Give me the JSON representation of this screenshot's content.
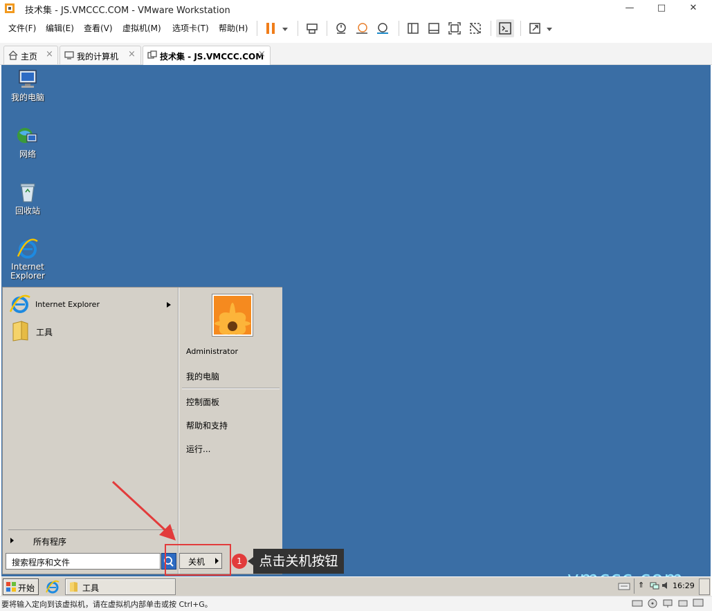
{
  "window": {
    "title": "技术集 - JS.VMCCC.COM - VMware Workstation",
    "minimize": "—",
    "maximize": "□",
    "close": "✕"
  },
  "menu": [
    "文件(F)",
    "编辑(E)",
    "查看(V)",
    "虚拟机(M)",
    "选项卡(T)",
    "帮助(H)"
  ],
  "tabs": [
    {
      "label": "主页",
      "icon": "home-icon"
    },
    {
      "label": "我的计算机",
      "icon": "monitor-icon"
    },
    {
      "label": "技术集 - JS.VMCCC.COM",
      "icon": "vm-icon",
      "active": true
    }
  ],
  "desktop_icons": [
    {
      "label": "我的电脑",
      "icon": "computer-icon"
    },
    {
      "label": "网络",
      "icon": "network-icon"
    },
    {
      "label": "回收站",
      "icon": "recycle-bin-icon"
    },
    {
      "label": "Internet\nExplorer",
      "icon": "ie-icon"
    }
  ],
  "start_menu": {
    "pinned": [
      {
        "label": "Internet Explorer",
        "has_submenu": true
      },
      {
        "label": "工具",
        "has_submenu": false
      }
    ],
    "all_programs": "所有程序",
    "search_placeholder": "搜索程序和文件",
    "shutdown": "关机",
    "right": {
      "user": "Administrator",
      "items": [
        "我的电脑",
        "控制面板",
        "帮助和支持",
        "运行..."
      ]
    }
  },
  "annotation": {
    "number": "1",
    "text": "点击关机按钮",
    "color": "#e23b3b"
  },
  "taskbar": {
    "start": "开始",
    "open_window": "工具",
    "clock": "16:29"
  },
  "watermark": "vmccc.com",
  "status": "要将输入定向到该虚拟机，请在虚拟机内部单击或按 Ctrl+G。",
  "colors": {
    "desktop": "#3a6ea5",
    "accent": "#e23b3b",
    "pause": "#f07d1a"
  }
}
